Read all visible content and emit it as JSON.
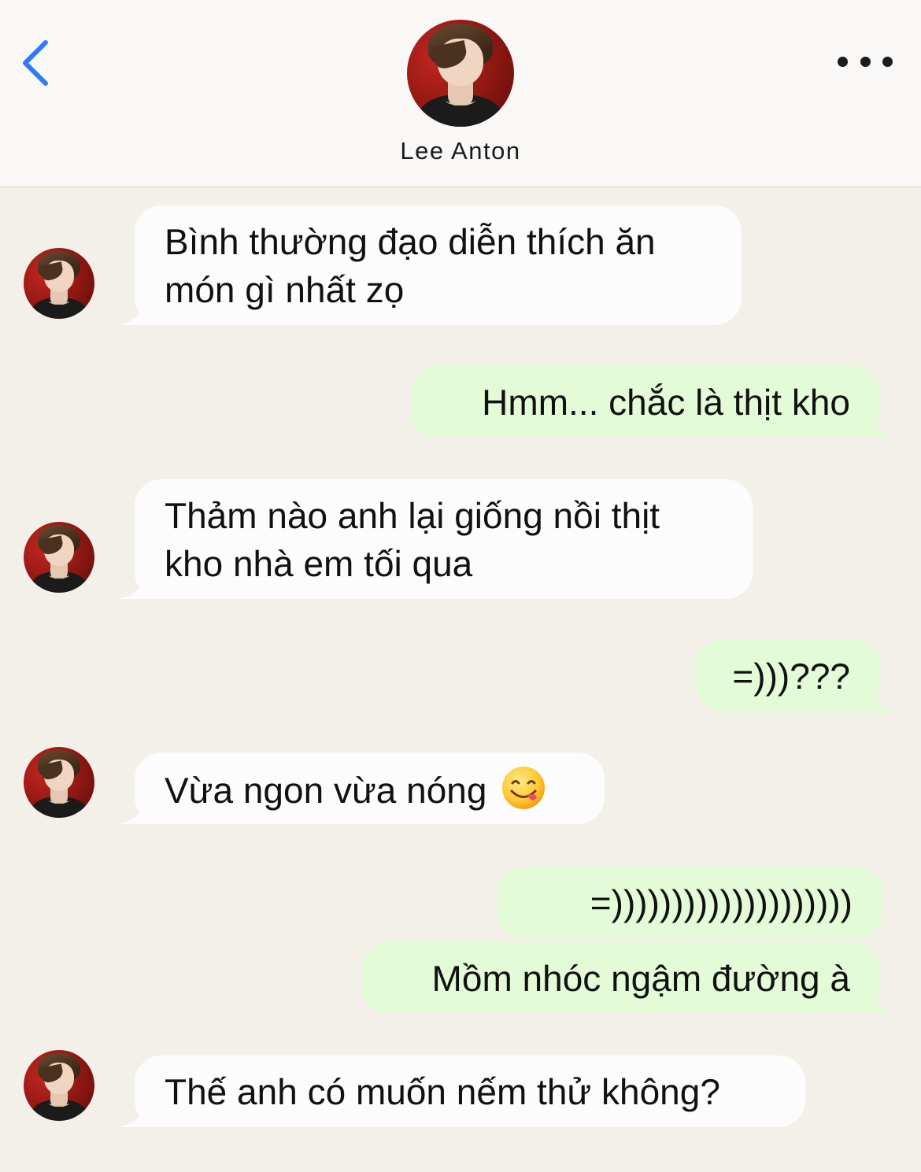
{
  "header": {
    "back_icon": "chevron-left-icon",
    "more_icon": "ellipsis-icon",
    "contact_name": "Lee Anton",
    "accent_color": "#2b7cf6"
  },
  "messages": [
    {
      "dir": "in",
      "lines": [
        "Bình thường đạo diễn thích ăn",
        "món gì nhất zọ"
      ]
    },
    {
      "dir": "out",
      "lines": [
        "Hmm... chắc là thịt kho"
      ]
    },
    {
      "dir": "in",
      "lines": [
        "Thảm nào anh lại giống nồi thịt",
        "kho nhà em tối qua"
      ]
    },
    {
      "dir": "out",
      "lines": [
        "=)))???"
      ]
    },
    {
      "dir": "in",
      "lines": [
        "Vừa ngon vừa nóng"
      ],
      "emoji": "yummy-face-emoji"
    },
    {
      "dir": "out",
      "lines": [
        "=))))))))))))))))))))"
      ]
    },
    {
      "dir": "out",
      "lines": [
        "Mồm nhóc ngậm đường à"
      ]
    },
    {
      "dir": "in",
      "lines": [
        "Thế anh có muốn nếm thử không?"
      ]
    }
  ],
  "colors": {
    "background": "#f3f0ea",
    "incoming_bubble": "#fcfcfc",
    "outgoing_bubble": "#e3fbd6"
  }
}
